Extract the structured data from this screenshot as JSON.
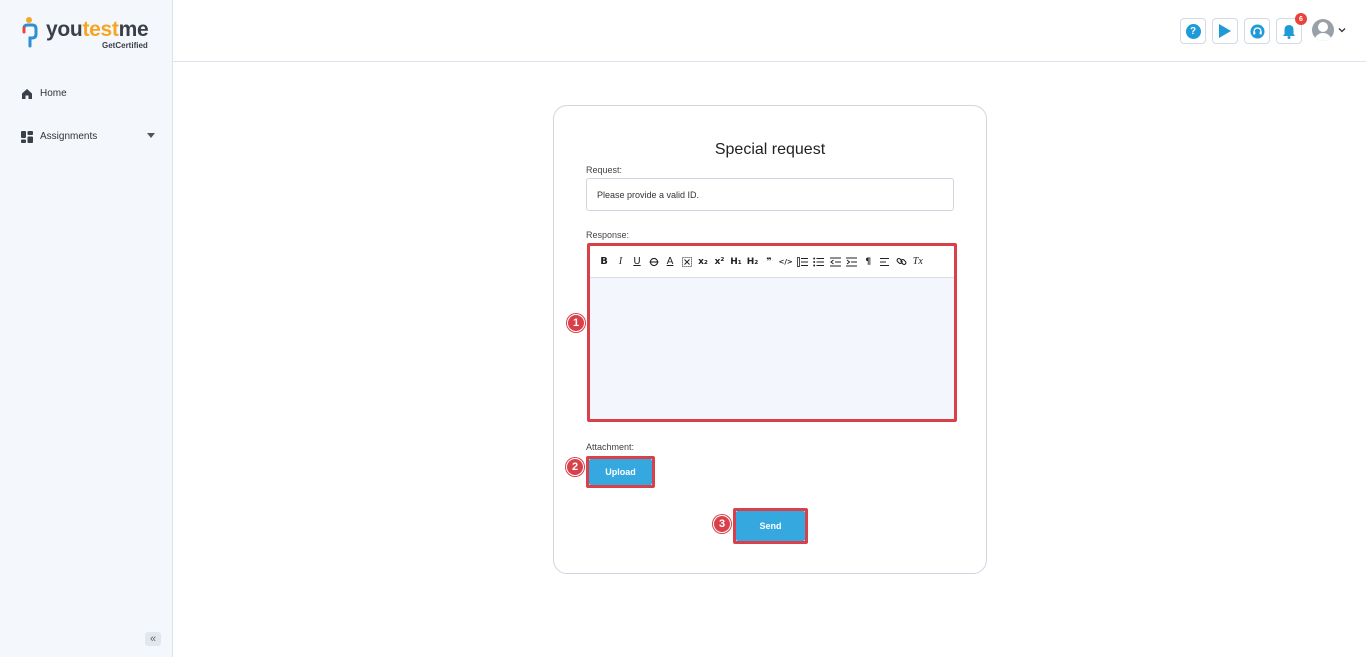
{
  "brand": {
    "name_prefix": "you",
    "name_accent": "test",
    "name_suffix": "me",
    "tagline": "GetCertified",
    "accent_color": "#f5a623"
  },
  "sidebar": {
    "items": [
      {
        "label": "Home",
        "icon": "home-icon"
      },
      {
        "label": "Assignments",
        "icon": "dashboard-icon",
        "has_dropdown": true
      }
    ],
    "collapse_label": "«"
  },
  "header": {
    "buttons": [
      {
        "name": "help-button",
        "icon": "question-icon",
        "glyph": "?"
      },
      {
        "name": "play-button",
        "icon": "play-icon"
      },
      {
        "name": "support-button",
        "icon": "headset-icon"
      },
      {
        "name": "notifications-button",
        "icon": "bell-icon",
        "badge": "6"
      }
    ],
    "notification_count": "6",
    "primary_color": "#1e9ad6"
  },
  "form": {
    "title": "Special request",
    "request_label": "Request:",
    "request_value": "Please provide a valid ID.",
    "response_label": "Response:",
    "attachment_label": "Attachment:",
    "upload_label": "Upload",
    "send_label": "Send",
    "toolbar": [
      "B",
      "I",
      "U",
      "S",
      "A",
      "▦",
      "x₂",
      "x²",
      "H₁",
      "H₂",
      "❞",
      "</>",
      "≔",
      "☰",
      "⇤",
      "⇥",
      "¶",
      "≡",
      "🔗",
      "Tx"
    ]
  },
  "markers": {
    "editor": "1",
    "upload": "2",
    "send": "3",
    "color": "#d9414a"
  }
}
